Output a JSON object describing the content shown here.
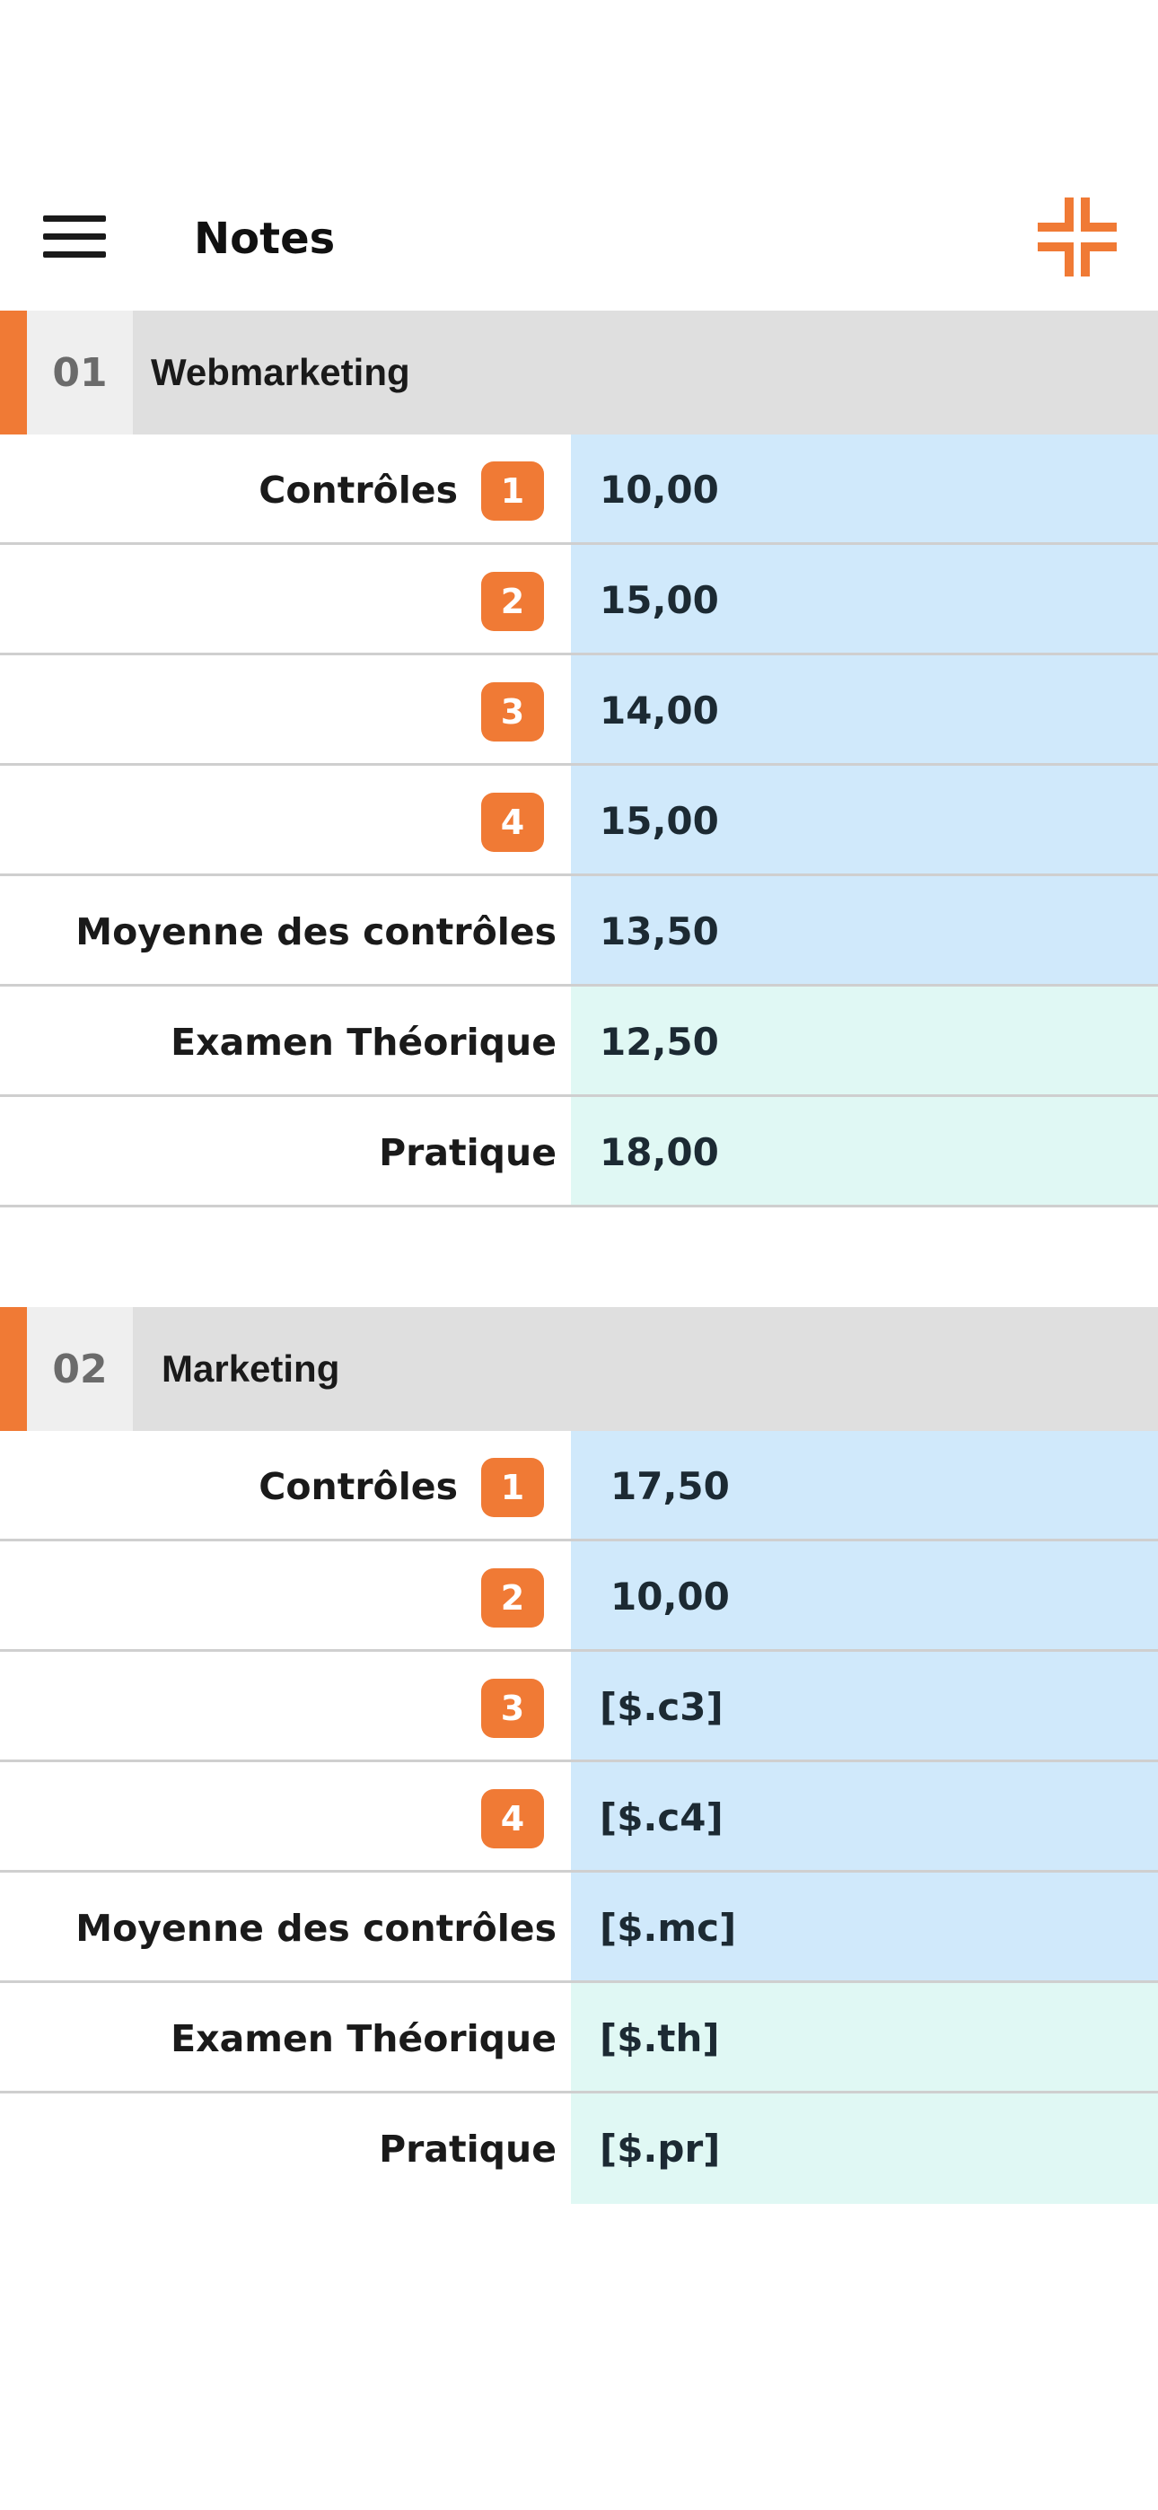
{
  "appbar": {
    "title": "Notes",
    "menu_icon": "hamburger-menu-icon",
    "collapse_icon": "collapse-arrows-icon",
    "accent_color": "#f07a35"
  },
  "colors": {
    "accent": "#f07a35",
    "header_bg": "#dfdfdf",
    "controls_cell_bg": "#d0e9fb",
    "exam_cell_bg": "#e0f8f4"
  },
  "sections": [
    {
      "number": "01",
      "name": "Webmarketing",
      "rows": [
        {
          "label": "Contrôles",
          "badge": "1",
          "value": "10,00"
        },
        {
          "label": "",
          "badge": "2",
          "value": "15,00"
        },
        {
          "label": "",
          "badge": "3",
          "value": "14,00"
        },
        {
          "label": "",
          "badge": "4",
          "value": "15,00"
        },
        {
          "label": "Moyenne des contrôles",
          "badge": "",
          "value": "13,50"
        },
        {
          "label": "Examen Théorique",
          "badge": "",
          "value": "12,50"
        },
        {
          "label": "Pratique",
          "badge": "",
          "value": "18,00"
        }
      ]
    },
    {
      "number": "02",
      "name": "Marketing",
      "rows": [
        {
          "label": "Contrôles",
          "badge": "1",
          "value": "17,50"
        },
        {
          "label": "",
          "badge": "2",
          "value": "10,00"
        },
        {
          "label": "",
          "badge": "3",
          "value": "[$.c3]"
        },
        {
          "label": "",
          "badge": "4",
          "value": "[$.c4]"
        },
        {
          "label": "Moyenne des contrôles",
          "badge": "",
          "value": "[$.mc]"
        },
        {
          "label": "Examen Théorique",
          "badge": "",
          "value": "[$.th]"
        },
        {
          "label": "Pratique",
          "badge": "",
          "value": "[$.pr]"
        }
      ]
    }
  ]
}
